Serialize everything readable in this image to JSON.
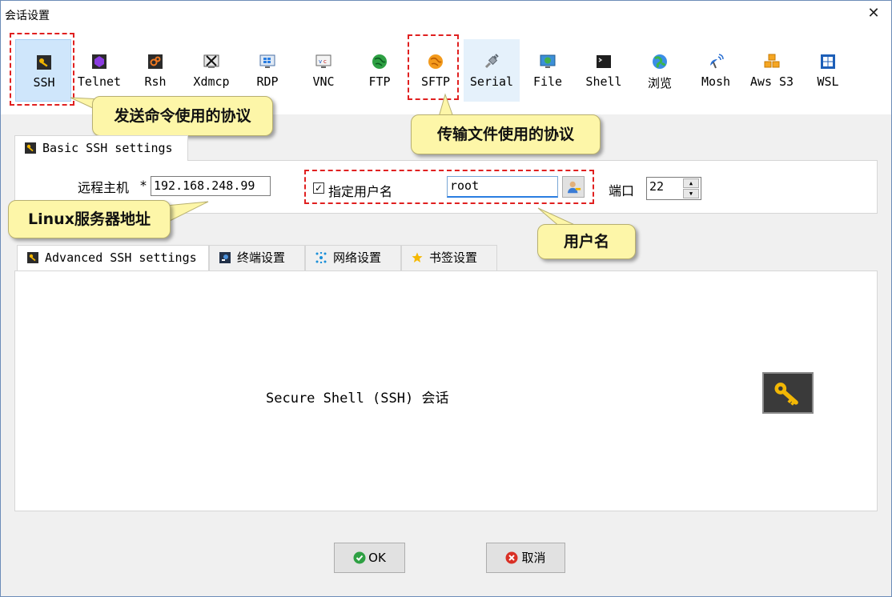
{
  "window": {
    "title": "会话设置",
    "close_glyph": "✕"
  },
  "protocols": [
    {
      "label": "SSH",
      "icon": "key-icon"
    },
    {
      "label": "Telnet",
      "icon": "telnet-icon"
    },
    {
      "label": "Rsh",
      "icon": "rsh-icon"
    },
    {
      "label": "Xdmcp",
      "icon": "xdmcp-icon"
    },
    {
      "label": "RDP",
      "icon": "rdp-icon"
    },
    {
      "label": "VNC",
      "icon": "vnc-icon"
    },
    {
      "label": "FTP",
      "icon": "ftp-globe-icon"
    },
    {
      "label": "SFTP",
      "icon": "sftp-globe-icon"
    },
    {
      "label": "Serial",
      "icon": "serial-plug-icon"
    },
    {
      "label": "File",
      "icon": "file-monitor-icon"
    },
    {
      "label": "Shell",
      "icon": "shell-terminal-icon"
    },
    {
      "label": "浏览",
      "icon": "browser-globe-icon"
    },
    {
      "label": "Mosh",
      "icon": "mosh-satellite-icon"
    },
    {
      "label": "Aws S3",
      "icon": "aws-cubes-icon"
    },
    {
      "label": "WSL",
      "icon": "windows-logo-icon"
    }
  ],
  "selected_protocol": "SSH",
  "annotations": {
    "send_protocol": "发送命令使用的协议",
    "transfer_protocol": "传输文件使用的协议",
    "linux_server": "Linux服务器地址",
    "username": "用户名"
  },
  "basic_tab": {
    "label": "Basic SSH settings"
  },
  "basic": {
    "remote_host_label": "远程主机",
    "required_mark": "*",
    "remote_host_value": "192.168.248.99",
    "specify_username_label": "指定用户名",
    "specify_username_checked": true,
    "username_value": "root",
    "port_label": "端口",
    "port_value": "22"
  },
  "lower_tabs": [
    {
      "label": "Advanced SSH settings",
      "icon": "key-icon"
    },
    {
      "label": "终端设置",
      "icon": "terminal-icon"
    },
    {
      "label": "网络设置",
      "icon": "network-icon"
    },
    {
      "label": "书签设置",
      "icon": "star-icon"
    }
  ],
  "content": {
    "description": "Secure Shell (SSH) 会话"
  },
  "buttons": {
    "ok": "OK",
    "cancel": "取消"
  },
  "colors": {
    "callout_bg": "#fdf6a8",
    "dashed_highlight": "#e02020",
    "selected_bg": "#cfe6fb"
  }
}
